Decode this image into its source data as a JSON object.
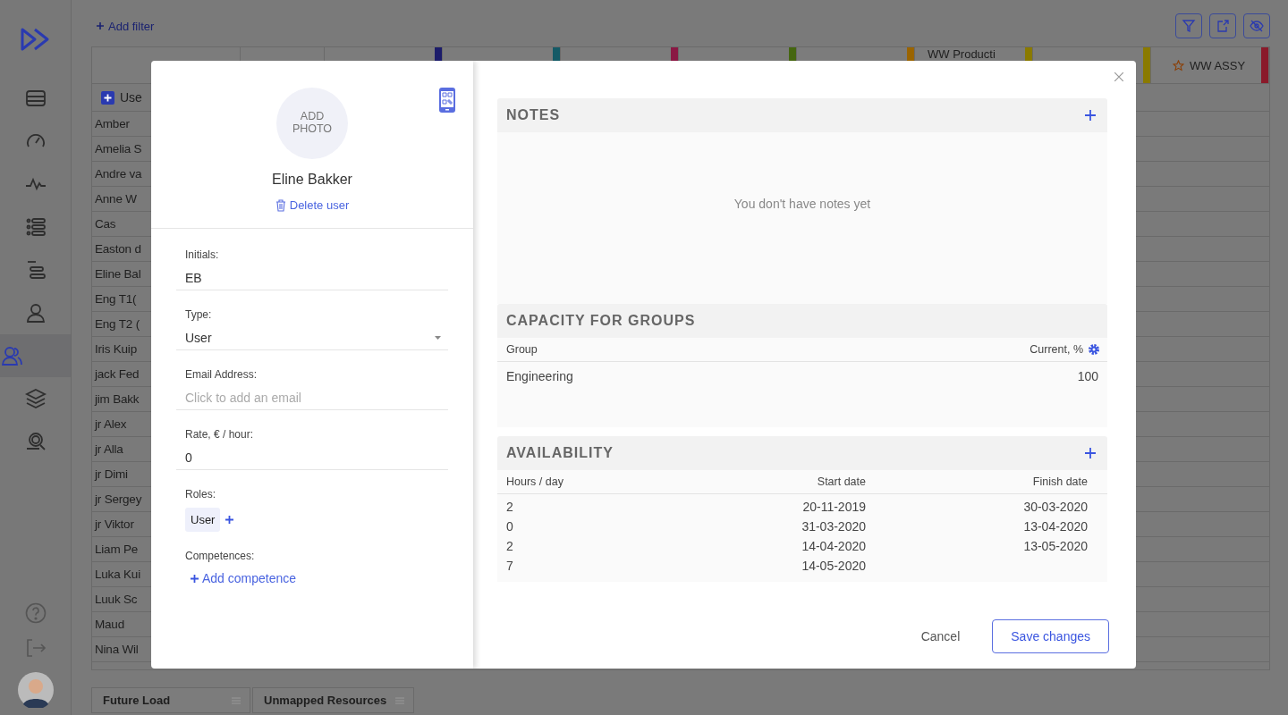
{
  "nav": [
    {
      "selected": false
    },
    {
      "selected": false
    },
    {
      "selected": false
    },
    {
      "selected": false
    },
    {
      "selected": false
    },
    {
      "selected": false
    },
    {
      "selected": true
    },
    {
      "selected": false
    },
    {
      "selected": false
    }
  ],
  "toolbar": {
    "add_filter": "Add filter"
  },
  "grid": {
    "user_header": "Use",
    "columns": [
      {
        "color": "#1c1c6a",
        "starred": false
      },
      {
        "color": "#145a66",
        "starred": false
      },
      {
        "color": "#8a1844",
        "starred": false
      },
      {
        "color": "#456610",
        "starred": false
      },
      {
        "color": "#9a6400",
        "starred": false
      },
      {
        "label": "WW Producti",
        "color": "#8a7a00",
        "starred": false
      },
      {
        "color": "#8a7a00",
        "starred": false
      },
      {
        "label": "WW ASSY",
        "starred": true,
        "color": "#8a1a2a"
      }
    ],
    "rows": [
      "Amber",
      "Amelia S",
      "Andre va",
      "Anne W",
      "Cas",
      "Easton d",
      "Eline Bal",
      "Eng T1(",
      "Eng T2 (",
      "Iris Kuip",
      "jack Fed",
      "jim Bakk",
      "jr Alex",
      "jr Alla",
      "jr Dimi",
      "jr Sergey",
      "jr Viktor",
      "Liam Pe",
      "Luka Kui",
      "Luuk Sc",
      "Maud",
      "Nina Wil"
    ]
  },
  "bottom_tabs": [
    "Future Load",
    "Unmapped Resources"
  ],
  "profile": {
    "photo_label": "ADD PHOTO",
    "name": "Eline Bakker",
    "delete": "Delete user"
  },
  "fields": [
    {
      "kind": "text",
      "label": "Initials:",
      "value": "EB"
    },
    {
      "kind": "select",
      "label": "Type:",
      "value": "User"
    },
    {
      "kind": "text",
      "label": "Email Address:",
      "placeholder": "Click to add an email"
    },
    {
      "kind": "text",
      "label": "Rate, € / hour:",
      "value": "0"
    }
  ],
  "roles": {
    "label": "Roles:",
    "tags": [
      "User"
    ]
  },
  "competences": {
    "label": "Competences:",
    "add": "Add competence"
  },
  "notes": {
    "title": "NOTES",
    "empty": "You don't have notes yet"
  },
  "capacity": {
    "title": "CAPACITY FOR GROUPS",
    "columns": [
      "Group",
      "Current, %"
    ],
    "rows": [
      {
        "group": "Engineering",
        "current": "100"
      }
    ]
  },
  "availability": {
    "title": "AVAILABILITY",
    "columns": [
      "Hours / day",
      "Start date",
      "Finish date"
    ],
    "rows": [
      {
        "hours": "2",
        "start": "20-11-2019",
        "finish": "30-03-2020"
      },
      {
        "hours": "0",
        "start": "31-03-2020",
        "finish": "13-04-2020"
      },
      {
        "hours": "2",
        "start": "14-04-2020",
        "finish": "13-05-2020"
      },
      {
        "hours": "7",
        "start": "14-05-2020"
      }
    ]
  },
  "buttons": {
    "cancel": "Cancel",
    "save": "Save changes"
  }
}
